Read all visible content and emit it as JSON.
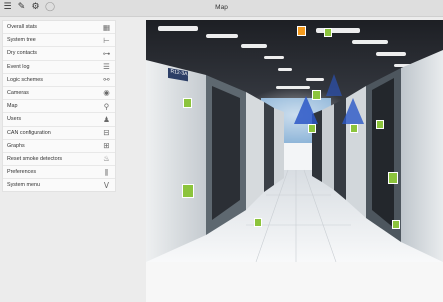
{
  "window": {
    "title": "Map"
  },
  "toolbar": {
    "icons": [
      "menu-icon",
      "edit-icon",
      "gear-icon",
      "info-icon"
    ]
  },
  "menu": {
    "items": [
      {
        "label": "Overall stats",
        "icon": "grid-icon"
      },
      {
        "label": "System tree",
        "icon": "tree-icon"
      },
      {
        "label": "Dry contacts",
        "icon": "contacts-icon"
      },
      {
        "label": "Event log",
        "icon": "list-icon"
      },
      {
        "label": "Logic schemes",
        "icon": "link-icon"
      },
      {
        "label": "Cameras",
        "icon": "eye-icon"
      },
      {
        "label": "Map",
        "icon": "location-pin-icon"
      },
      {
        "label": "Users",
        "icon": "user-icon"
      },
      {
        "label": "CAN configuration",
        "icon": "can-icon"
      },
      {
        "label": "Graphs",
        "icon": "chart-icon"
      },
      {
        "label": "Reset smoke detectors",
        "icon": "flame-icon"
      },
      {
        "label": "Preferences",
        "icon": "sliders-icon"
      },
      {
        "label": "System menu",
        "icon": "chevron-down-icon"
      }
    ]
  },
  "map": {
    "image_description_free": true,
    "rack_tag": "R12-3A",
    "colors": {
      "marker_green": "#8cc43c",
      "marker_orange": "#f39a1e",
      "camera_blue": "#2b57c7"
    }
  }
}
